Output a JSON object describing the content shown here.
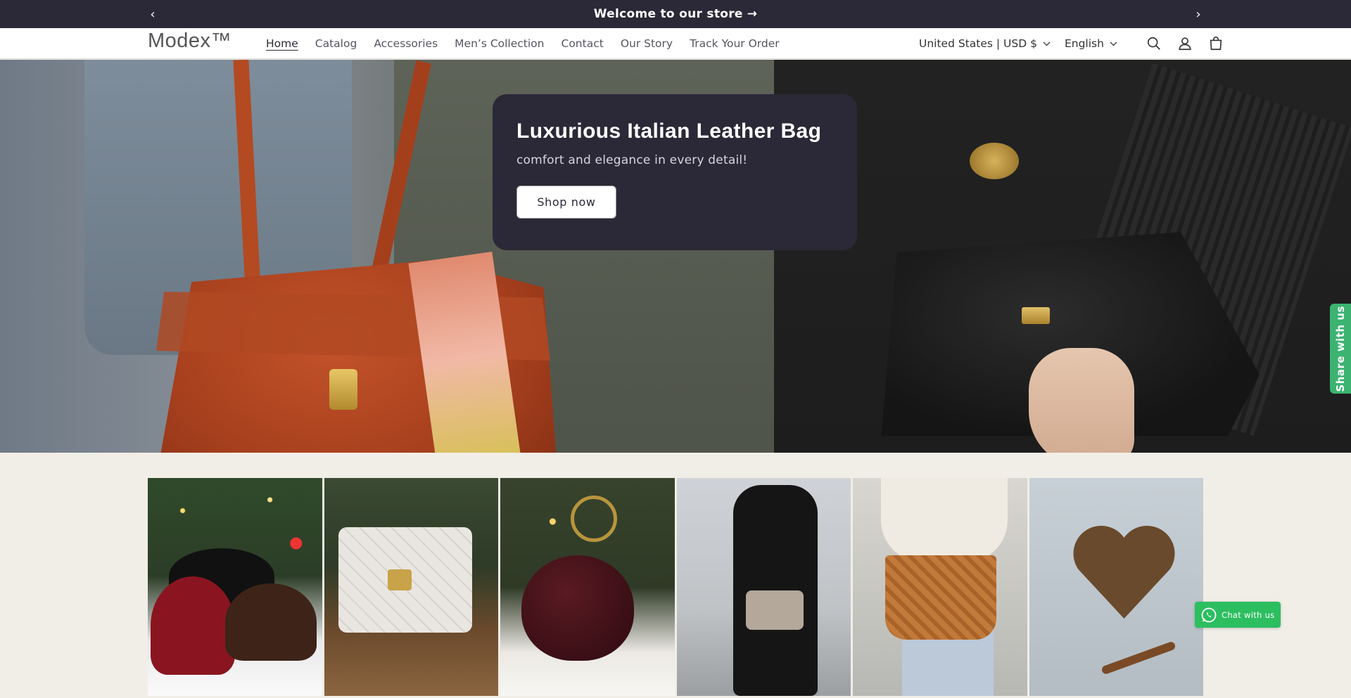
{
  "announcement": {
    "message": "Welcome to our store",
    "arrow": "→",
    "prev": "‹",
    "next": "›"
  },
  "header": {
    "logo": "Modex™",
    "nav": [
      {
        "label": "Home",
        "active": true
      },
      {
        "label": "Catalog"
      },
      {
        "label": "Accessories"
      },
      {
        "label": "Men’s Collection"
      },
      {
        "label": "Contact"
      },
      {
        "label": "Our Story"
      },
      {
        "label": "Track Your Order"
      }
    ],
    "country_selector": "United States | USD $",
    "language_selector": "English",
    "icons": [
      "search-icon",
      "account-icon",
      "cart-icon"
    ]
  },
  "hero": {
    "title": "Luxurious Italian Leather Bag",
    "subtitle": "comfort and elegance in every detail!",
    "cta": "Shop now"
  },
  "share_tab": {
    "label": "Share with us"
  },
  "chat": {
    "label": "Chat with us"
  },
  "colors": {
    "announcement_bg": "#2b2837",
    "hero_card_bg": "#2b2837",
    "page_bg": "#f1eee7",
    "share_green": "#3cb371",
    "whatsapp_green": "#2dbe60"
  }
}
